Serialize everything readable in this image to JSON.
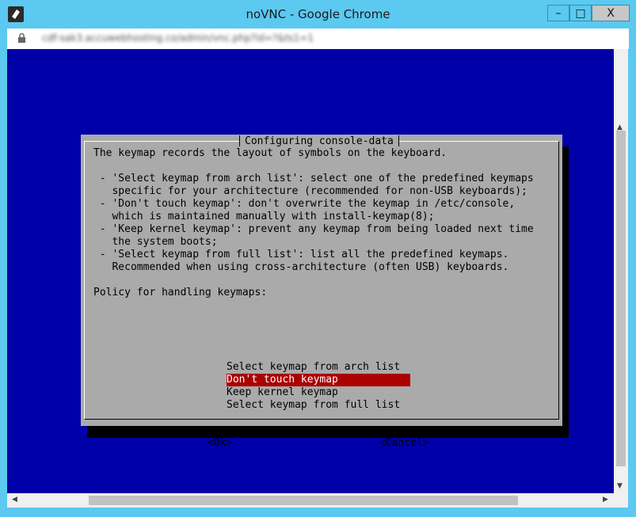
{
  "window": {
    "title": "noVNC - Google Chrome",
    "minimize_label": "–",
    "maximize_label": "□",
    "close_label": "X",
    "url": "cdf‑sak3.accuwebhosting.co/admin/vnc.php?id=?&ts1=1"
  },
  "dialog": {
    "title": "Configuring console-data",
    "body_lines": [
      "The keymap records the layout of symbols on the keyboard.",
      "",
      " - 'Select keymap from arch list': select one of the predefined keymaps",
      "   specific for your architecture (recommended for non-USB keyboards);",
      " - 'Don't touch keymap': don't overwrite the keymap in /etc/console,",
      "   which is maintained manually with install-keymap(8);",
      " - 'Keep kernel keymap': prevent any keymap from being loaded next time",
      "   the system boots;",
      " - 'Select keymap from full list': list all the predefined keymaps.",
      "   Recommended when using cross-architecture (often USB) keyboards.",
      "",
      "Policy for handling keymaps:"
    ],
    "options": [
      "Select keymap from arch list",
      "Don't touch keymap",
      "Keep kernel keymap",
      "Select keymap from full list"
    ],
    "selected_index": 1,
    "ok_label": "<Ok>",
    "cancel_label": "<Cancel>"
  },
  "colors": {
    "console_bg": "#0000a8",
    "dialog_bg": "#aaaaaa",
    "title_color": "#c40000",
    "selection_bg": "#aa0000",
    "chrome_frame": "#5bc9f0"
  }
}
